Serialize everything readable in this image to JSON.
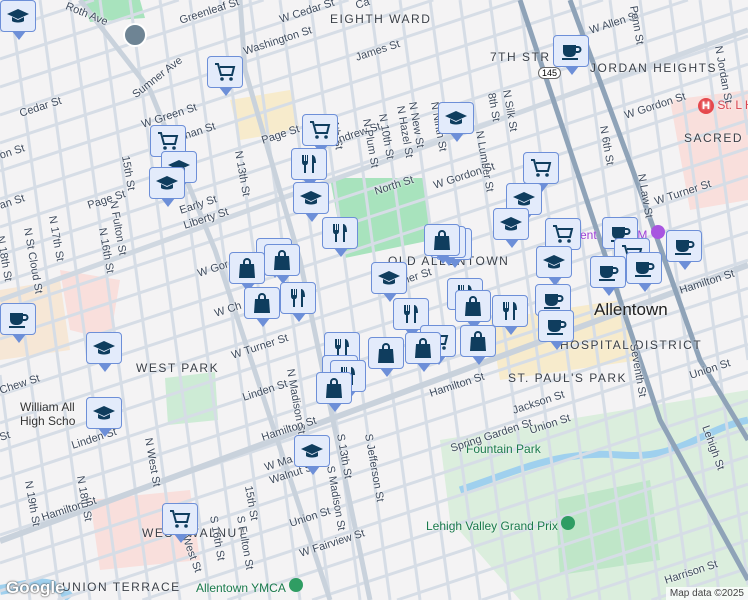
{
  "colors": {
    "marker_fill": "#e3ebfb",
    "marker_border": "#6d8fd8",
    "icon": "#0f3d5e",
    "park": "#a8e3bd",
    "road": "#d6dde6",
    "arterial": "#8fa3b8"
  },
  "districts": [
    "EIGHTH WARD",
    "7TH STR",
    "JORDAN HEIGHTS",
    "SACRED H",
    "OLD ALLENTOWN",
    "WEST PARK",
    "ST. PAUL'S PARK",
    "WEST WALNUT",
    "UNION TERRACE",
    "HOSPITAL DISTRICT"
  ],
  "city": "Allentown",
  "pois": [
    "St. L Hos",
    "Lehigh Valley Grand Prix",
    "Fountain Park",
    "Allentown YMCA",
    "William All High Scho",
    "ent",
    "rt M"
  ],
  "route_shield": "145",
  "streets": [
    "Roth Ave",
    "Greenleaf St",
    "W Cedar St",
    "Ca",
    "Washington St",
    "James St",
    "Sumner Ave",
    "W Green St",
    "Cedar St",
    "nan St",
    "Page St",
    "11th St",
    "Andrew St",
    "15th St",
    "N 13th St",
    "on St",
    "N Fulton St",
    "Page St",
    "N 16th St",
    "N 17th St",
    "N St Cloud St",
    "N 18th St",
    "an St",
    "Early St",
    "Liberty St",
    "W Gor",
    "N Ninth St",
    "N New St",
    "N Hazel St",
    "N 10th St",
    "N Plum St",
    "8th St",
    "N Silk St",
    "N Lumber St",
    "North St",
    "W Gordon St",
    "W Allen St",
    "N 6th St",
    "W Gordon St",
    "N Law St",
    "W Turner St",
    "Penn St",
    "N Jordan St",
    "Seventh St",
    "Hamilton St",
    "Union St",
    "Lehigh St",
    "W Ch",
    "W Turner St",
    "Linden St",
    "N Madison St",
    "Jackson St",
    "Union St",
    "Spring Garden St",
    "S Jefferson St",
    "S 13th St",
    "S Madison St",
    "Hamilton St",
    "Hamilton St",
    "Hamilton St",
    "W Ma",
    "Walnut St",
    "15th St",
    "S 16th St",
    "S Fulton St",
    "Union St",
    "W Fairview St",
    "Harrison St",
    "West St",
    "N West St",
    "Linden St",
    "N 18th St",
    "N 19th St",
    "Chew St",
    "Turner St",
    "St"
  ],
  "markers": [
    "cart",
    "cart",
    "school",
    "school",
    "cart",
    "restaurant",
    "school",
    "restaurant",
    "restaurant",
    "shopping",
    "shopping",
    "restaurant",
    "shopping",
    "school",
    "cart",
    "school",
    "school",
    "cart",
    "shopping",
    "shopping",
    "shopping",
    "school",
    "coffee",
    "cart",
    "coffee",
    "coffee",
    "coffee",
    "coffee",
    "school",
    "restaurant",
    "restaurant",
    "shopping",
    "restaurant",
    "coffee",
    "coffee",
    "cart",
    "shopping",
    "shopping",
    "shopping",
    "restaurant",
    "restaurant",
    "restaurant",
    "shopping",
    "school",
    "cart",
    "coffee",
    "school",
    "school",
    "school"
  ],
  "attribution": "Map data ©2025",
  "logo": "Google"
}
